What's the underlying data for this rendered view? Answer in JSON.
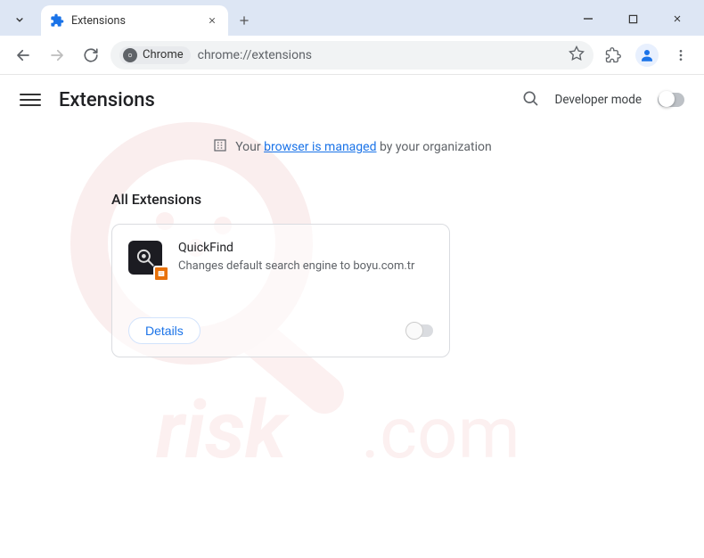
{
  "tab": {
    "title": "Extensions"
  },
  "omnibox": {
    "chip_label": "Chrome",
    "url": "chrome://extensions"
  },
  "header": {
    "page_title": "Extensions",
    "dev_mode_label": "Developer mode"
  },
  "managed": {
    "prefix": "Your ",
    "link": "browser is managed",
    "suffix": " by your organization"
  },
  "section_title": "All Extensions",
  "extension": {
    "name": "QuickFind",
    "description": "Changes default search engine to boyu.com.tr",
    "details_label": "Details"
  }
}
